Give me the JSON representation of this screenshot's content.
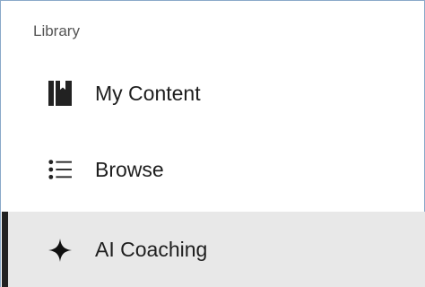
{
  "sidebar": {
    "section_heading": "Library",
    "items": [
      {
        "label": "My Content",
        "icon": "book-icon",
        "active": false
      },
      {
        "label": "Browse",
        "icon": "list-icon",
        "active": false
      },
      {
        "label": "AI Coaching",
        "icon": "sparkle-icon",
        "active": true
      }
    ]
  },
  "colors": {
    "active_background": "#e8e8e8",
    "active_indicator": "#222222",
    "border": "#8aa9c9"
  }
}
